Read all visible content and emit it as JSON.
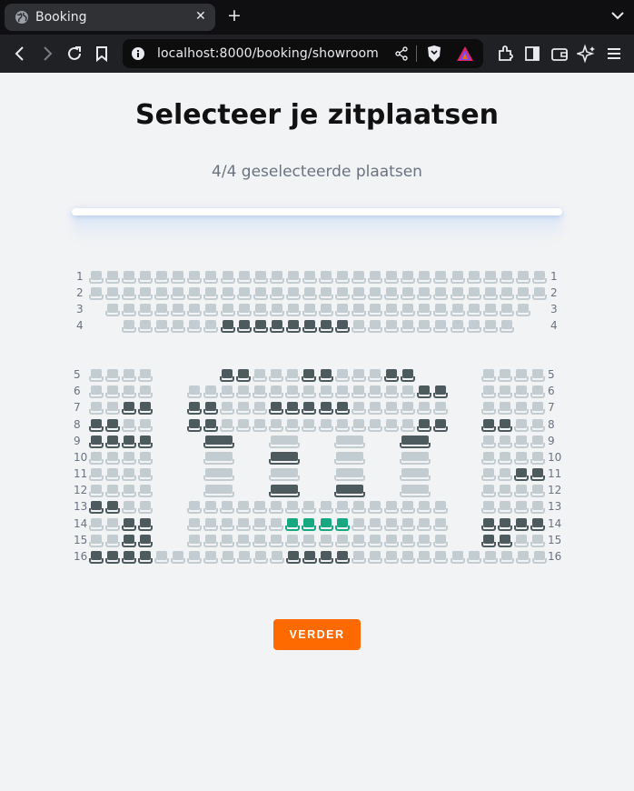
{
  "browser": {
    "tab_title": "Booking",
    "url": "localhost:8000/booking/showroom"
  },
  "page": {
    "title": "Selecteer je zitplaatsen",
    "selection_status": "4/4 geselecteerde plaatsen",
    "continue_label": "VERDER"
  },
  "colors": {
    "available": "#c3ccd0",
    "occupied": "#4d5a5e",
    "selected": "#17a882",
    "cta": "#ff6a00"
  },
  "seat_legend_note": "",
  "hall": {
    "front_rows": [
      "1",
      "2",
      "3",
      "4"
    ],
    "back_rows": [
      "5",
      "6",
      "7",
      "8",
      "9",
      "10",
      "11",
      "12",
      "13",
      "14",
      "15",
      "16"
    ],
    "occupied": {
      "4": [
        9,
        10,
        11,
        12,
        13,
        14,
        15,
        16
      ],
      "5": [
        "c1",
        "c2",
        "c6",
        "c7",
        "c11",
        "c12"
      ],
      "6": [
        "c15",
        "c16"
      ],
      "7": [
        "l3",
        "l4",
        "c1",
        "c2",
        "c6",
        "c7",
        "c8",
        "c9",
        "c10"
      ],
      "8": [
        "l1",
        "l2",
        "c1",
        "c2",
        "c15",
        "c16",
        "r1",
        "r2"
      ],
      "9": [
        "l1",
        "l2",
        "l3",
        "l4",
        "b1",
        "b4"
      ],
      "10": [
        "b2"
      ],
      "11": [
        "r3",
        "r4"
      ],
      "12": [
        "b2",
        "b3"
      ],
      "13": [
        "l1",
        "l2"
      ],
      "14": [
        "l3",
        "l4",
        "r1",
        "r2",
        "r3",
        "r4"
      ],
      "15": [
        "l3",
        "l4",
        "r1",
        "r2"
      ],
      "16": [
        "s1",
        "s2",
        "s3",
        "s4",
        "s13",
        "s14",
        "s15",
        "s16"
      ]
    },
    "selected": {
      "14": [
        "c7",
        "c8",
        "c9",
        "c10"
      ]
    }
  }
}
